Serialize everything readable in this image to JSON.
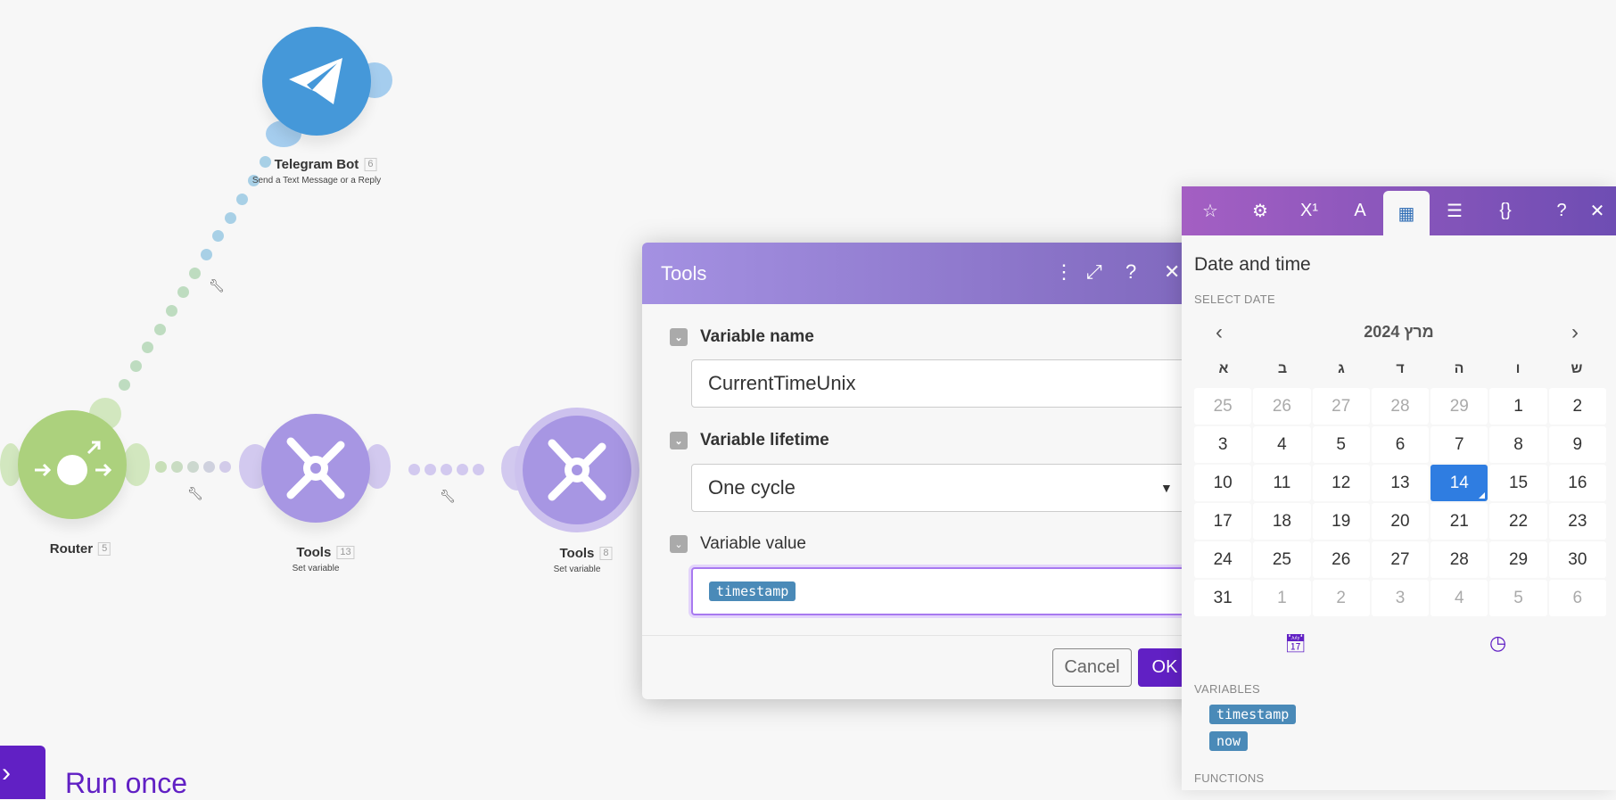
{
  "canvas": {
    "nodes": [
      {
        "title": "Telegram Bot",
        "id": "6",
        "subtitle": "Send a Text Message or a Reply",
        "icon": "telegram-icon",
        "color": "#4598d9"
      },
      {
        "title": "Router",
        "id": "5",
        "icon": "router-icon",
        "color": "#acd17d"
      },
      {
        "title": "Tools",
        "id": "13",
        "subtitle": "Set variable",
        "icon": "tools-icon",
        "color": "#a796e3"
      },
      {
        "title": "Tools",
        "id": "8",
        "subtitle": "Set variable",
        "icon": "tools-icon",
        "color": "#a796e3"
      }
    ],
    "run_once_label": "Run once"
  },
  "modal": {
    "title": "Tools",
    "fields": [
      {
        "label": "Variable name",
        "value": "CurrentTimeUnix"
      },
      {
        "label": "Variable lifetime",
        "value": "One cycle"
      },
      {
        "label": "Variable value",
        "value": "timestamp"
      }
    ],
    "cancel_label": "Cancel",
    "ok_label": "OK"
  },
  "panel": {
    "tabs": [
      {
        "icon": "star-icon",
        "glyph": "☆"
      },
      {
        "icon": "gear-icon",
        "glyph": "⚙"
      },
      {
        "icon": "superscript-icon",
        "glyph": "X¹"
      },
      {
        "icon": "text-icon",
        "glyph": "A"
      },
      {
        "icon": "calendar-icon",
        "glyph": "▦"
      },
      {
        "icon": "table-icon",
        "glyph": "☰"
      },
      {
        "icon": "braces-icon",
        "glyph": "{}"
      }
    ],
    "help_glyph": "?",
    "close_glyph": "✕",
    "title": "Date and time",
    "select_date_label": "SELECT DATE",
    "month_label": "מרץ 2024",
    "weekdays": [
      "א",
      "ב",
      "ג",
      "ד",
      "ה",
      "ו",
      "ש"
    ],
    "days": [
      {
        "d": "25",
        "m": true
      },
      {
        "d": "26",
        "m": true
      },
      {
        "d": "27",
        "m": true
      },
      {
        "d": "28",
        "m": true
      },
      {
        "d": "29",
        "m": true
      },
      {
        "d": "1"
      },
      {
        "d": "2"
      },
      {
        "d": "3"
      },
      {
        "d": "4"
      },
      {
        "d": "5"
      },
      {
        "d": "6"
      },
      {
        "d": "7"
      },
      {
        "d": "8"
      },
      {
        "d": "9"
      },
      {
        "d": "10"
      },
      {
        "d": "11"
      },
      {
        "d": "12"
      },
      {
        "d": "13"
      },
      {
        "d": "14",
        "s": true
      },
      {
        "d": "15"
      },
      {
        "d": "16"
      },
      {
        "d": "17"
      },
      {
        "d": "18"
      },
      {
        "d": "19"
      },
      {
        "d": "20"
      },
      {
        "d": "21"
      },
      {
        "d": "22"
      },
      {
        "d": "23"
      },
      {
        "d": "24"
      },
      {
        "d": "25"
      },
      {
        "d": "26"
      },
      {
        "d": "27"
      },
      {
        "d": "28"
      },
      {
        "d": "29"
      },
      {
        "d": "30"
      },
      {
        "d": "31"
      },
      {
        "d": "1",
        "m": true
      },
      {
        "d": "2",
        "m": true
      },
      {
        "d": "3",
        "m": true
      },
      {
        "d": "4",
        "m": true
      },
      {
        "d": "5",
        "m": true
      },
      {
        "d": "6",
        "m": true
      }
    ],
    "selected_day": "14",
    "variables_label": "VARIABLES",
    "variables": [
      "timestamp",
      "now"
    ],
    "functions_label": "FUNCTIONS",
    "accent": "#6120c4"
  }
}
